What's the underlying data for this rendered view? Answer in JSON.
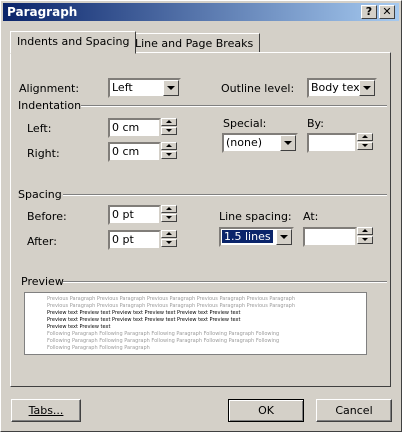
{
  "window": {
    "title": "Paragraph",
    "help_glyph": "?",
    "close_glyph": "✕"
  },
  "tabs": [
    {
      "label": "Indents and Spacing",
      "active": true
    },
    {
      "label": "Line and Page Breaks",
      "active": false
    }
  ],
  "general": {
    "alignment_label": "Alignment:",
    "alignment_value": "Left",
    "outline_label": "Outline level:",
    "outline_value": "Body text"
  },
  "indentation": {
    "group_label": "Indentation",
    "left_label": "Left:",
    "left_value": "0 cm",
    "right_label": "Right:",
    "right_value": "0 cm",
    "special_label": "Special:",
    "special_value": "(none)",
    "by_label": "By:",
    "by_value": ""
  },
  "spacing": {
    "group_label": "Spacing",
    "before_label": "Before:",
    "before_value": "0 pt",
    "after_label": "After:",
    "after_value": "0 pt",
    "line_spacing_label": "Line spacing:",
    "line_spacing_value": "1.5 lines",
    "at_label": "At:",
    "at_value": ""
  },
  "preview": {
    "group_label": "Preview",
    "lines": [
      {
        "text": "Previous Paragraph Previous Paragraph Previous Paragraph Previous Paragraph Previous Paragraph",
        "tone": "grey"
      },
      {
        "text": "Previous Paragraph Previous Paragraph Previous Paragraph Previous Paragraph Previous Paragraph",
        "tone": "grey"
      },
      {
        "text": "Preview text Preview text Preview text Preview text Preview text Preview text",
        "tone": "dark"
      },
      {
        "text": "Preview text Preview text Preview text Preview text Preview text Preview text",
        "tone": "dark"
      },
      {
        "text": "Preview text Preview text",
        "tone": "dark"
      },
      {
        "text": "Following Paragraph Following Paragraph Following Paragraph Following Paragraph Following",
        "tone": "grey"
      },
      {
        "text": "Following Paragraph Following Paragraph Following Paragraph Following Paragraph Following",
        "tone": "grey"
      },
      {
        "text": "Following Paragraph Following Paragraph",
        "tone": "grey"
      }
    ]
  },
  "buttons": {
    "tabs": "Tabs...",
    "ok": "OK",
    "cancel": "Cancel"
  }
}
